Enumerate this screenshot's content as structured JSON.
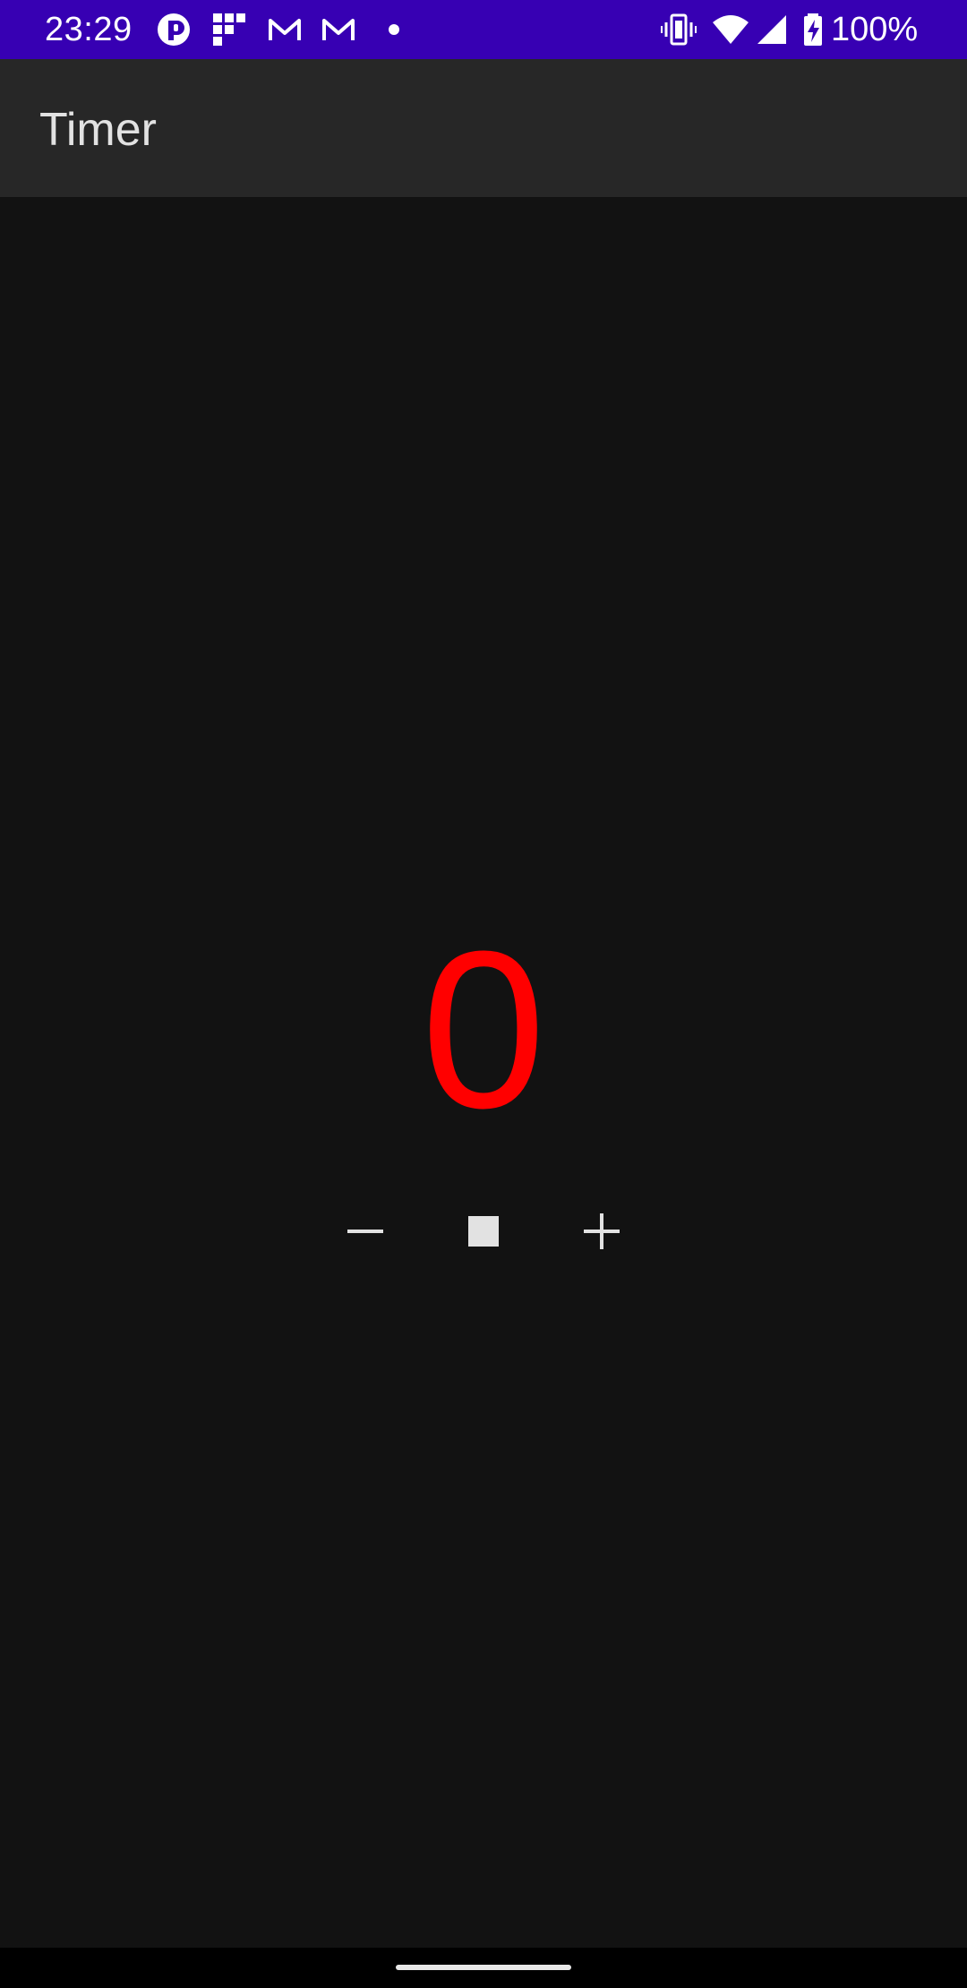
{
  "status_bar": {
    "time": "23:29",
    "battery": "100%",
    "notification_icons": [
      "vpn-key-icon",
      "grid-app-icon",
      "gmail-icon",
      "gmail-icon",
      "more-dot-icon"
    ],
    "system_icons": [
      "vibrate-icon",
      "wifi-icon",
      "cell-signal-icon",
      "battery-charging-icon"
    ],
    "background_color": "#3700b3"
  },
  "app_bar": {
    "title": "Timer",
    "background_color": "#272727"
  },
  "timer": {
    "value": "0",
    "color": "#ff0000"
  },
  "controls": {
    "decrement_icon": "minus-icon",
    "stop_icon": "stop-icon",
    "increment_icon": "plus-icon"
  },
  "nav_bar": {
    "handle": "gesture-handle"
  }
}
